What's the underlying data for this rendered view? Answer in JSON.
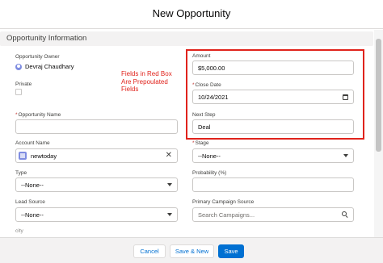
{
  "modal": {
    "title": "New Opportunity"
  },
  "section": {
    "title": "Opportunity Information"
  },
  "fields": {
    "owner": {
      "label": "Opportunity Owner",
      "value": "Devraj Chaudhary"
    },
    "private": {
      "label": "Private",
      "checked": false
    },
    "opportunity_name": {
      "label": "Opportunity Name",
      "value": ""
    },
    "account_name": {
      "label": "Account Name",
      "value": "newtoday"
    },
    "type": {
      "label": "Type",
      "value": "--None--"
    },
    "lead_source": {
      "label": "Lead Source",
      "value": "--None--"
    },
    "city": {
      "label": "city"
    },
    "amount": {
      "label": "Amount",
      "value": "$5,000.00"
    },
    "close_date": {
      "label": "Close Date",
      "value": "10/24/2021"
    },
    "next_step": {
      "label": "Next Step",
      "value": "Deal"
    },
    "stage": {
      "label": "Stage",
      "value": "--None--"
    },
    "probability": {
      "label": "Probability (%)",
      "value": ""
    },
    "campaign": {
      "label": "Primary Campaign Source",
      "placeholder": "Search Campaigns..."
    }
  },
  "annotation": {
    "lines": [
      "Fields in Red Box",
      "Are Prepoulated",
      "Fields"
    ],
    "color": "#e0231c"
  },
  "footer": {
    "cancel_label": "Cancel",
    "save_new_label": "Save & New",
    "save_label": "Save"
  },
  "colors": {
    "brand": "#0070d2",
    "required": "#c23934",
    "annotation": "#e0231c"
  }
}
